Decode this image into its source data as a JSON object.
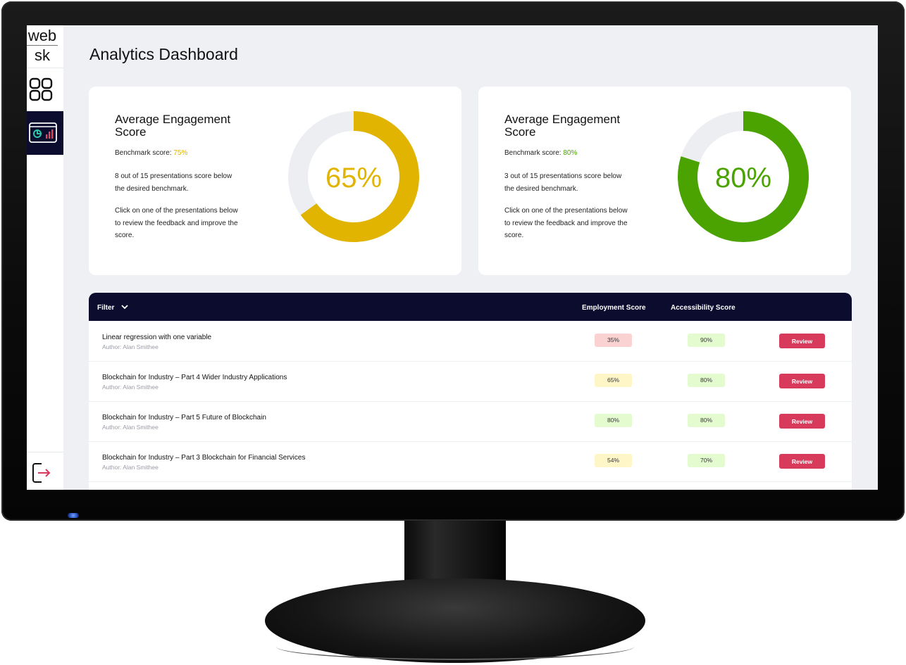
{
  "app": {
    "logo_line1": "web",
    "logo_line2": "sk",
    "page_title": "Analytics Dashboard"
  },
  "sidebar": {
    "items": [
      {
        "icon": "grid-icon",
        "active": false
      },
      {
        "icon": "analytics-icon",
        "active": true
      },
      {
        "icon": "logout-icon",
        "active": false
      }
    ]
  },
  "cards": [
    {
      "title": "Average Engagement Score",
      "benchmark_label": "Benchmark score: ",
      "benchmark_value": "75%",
      "summary": "8 out of 15 presentations score below the desired benchmark.",
      "instruction": "Click on one of the presentations below to review the feedback and improve the score.",
      "score_text": "65%",
      "score": 65,
      "color": "#e0b400"
    },
    {
      "title": "Average Engagement Score",
      "benchmark_label": "Benchmark score: ",
      "benchmark_value": "80%",
      "summary": "3 out of 15 presentations score below the desired benchmark.",
      "instruction": "Click on one of the presentations below to review the feedback and improve the score.",
      "score_text": "80%",
      "score": 80,
      "color": "#4aa300"
    }
  ],
  "table": {
    "filter_label": "Filter",
    "columns": {
      "employment": "Employment Score",
      "accessibility": "Accessibility Score"
    },
    "rows": [
      {
        "title": "Linear regression with one variable",
        "author": "Author: Alan Smithee",
        "employment": "35%",
        "employment_status": "red",
        "accessibility": "90%",
        "accessibility_status": "green",
        "action": "Review"
      },
      {
        "title": "Blockchain for Industry – Part 4 Wider Industry Applications",
        "author": "Author: Alan Smithee",
        "employment": "65%",
        "employment_status": "yellow",
        "accessibility": "80%",
        "accessibility_status": "green",
        "action": "Review"
      },
      {
        "title": "Blockchain for Industry – Part 5 Future of Blockchain",
        "author": "Author: Alan Smithee",
        "employment": "80%",
        "employment_status": "green",
        "accessibility": "80%",
        "accessibility_status": "green",
        "action": "Review"
      },
      {
        "title": "Blockchain for Industry – Part 3 Blockchain for Financial Services",
        "author": "Author: Alan Smithee",
        "employment": "54%",
        "employment_status": "yellow",
        "accessibility": "70%",
        "accessibility_status": "green",
        "action": "Review"
      }
    ]
  },
  "colors": {
    "navy": "#0b0c2e",
    "accent_red": "#d83a5c",
    "track": "#eceef2"
  }
}
